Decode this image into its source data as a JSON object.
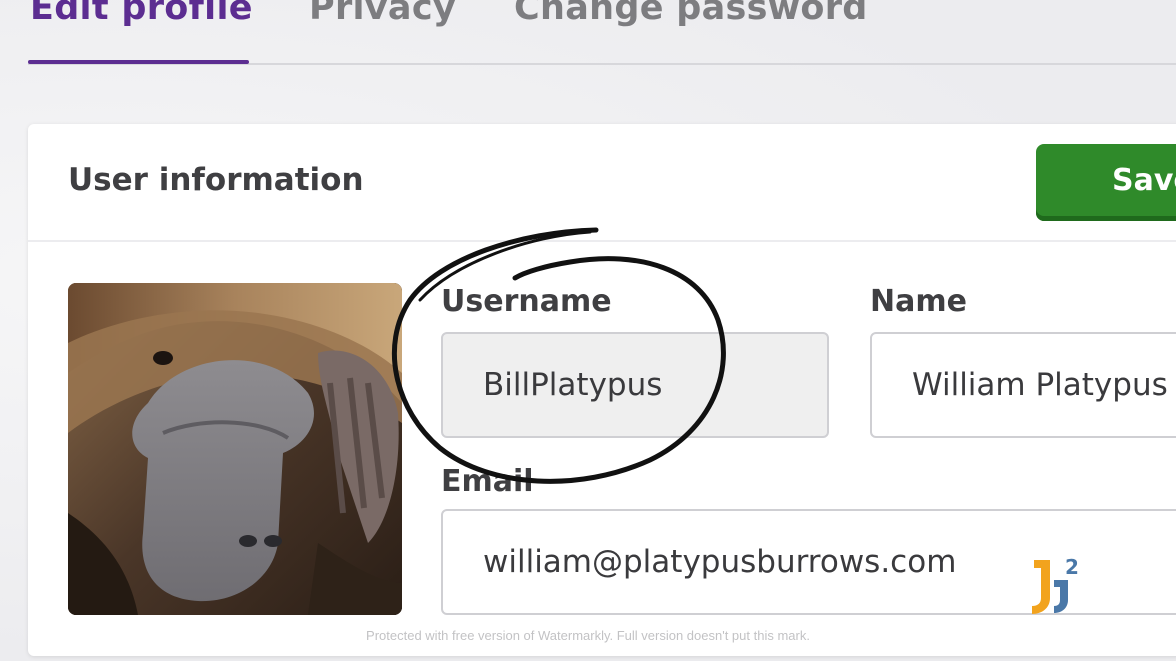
{
  "tabs": [
    {
      "label": "Edit profile",
      "active": true
    },
    {
      "label": "Privacy",
      "active": false
    },
    {
      "label": "Change password",
      "active": false
    }
  ],
  "card": {
    "title": "User information",
    "save_label": "Save"
  },
  "form": {
    "username": {
      "label": "Username",
      "value": "BillPlatypus"
    },
    "name": {
      "label": "Name",
      "value": "William Platypus"
    },
    "email": {
      "label": "Email",
      "value": "william@platypusburrows.com"
    }
  },
  "logo": {
    "text": "J2"
  },
  "watermark": "Protected with free version of Watermarkly. Full version doesn't put this mark.",
  "colors": {
    "accent": "#5c2d91",
    "save_button": "#2f8a2a",
    "annotation": "#111111"
  }
}
